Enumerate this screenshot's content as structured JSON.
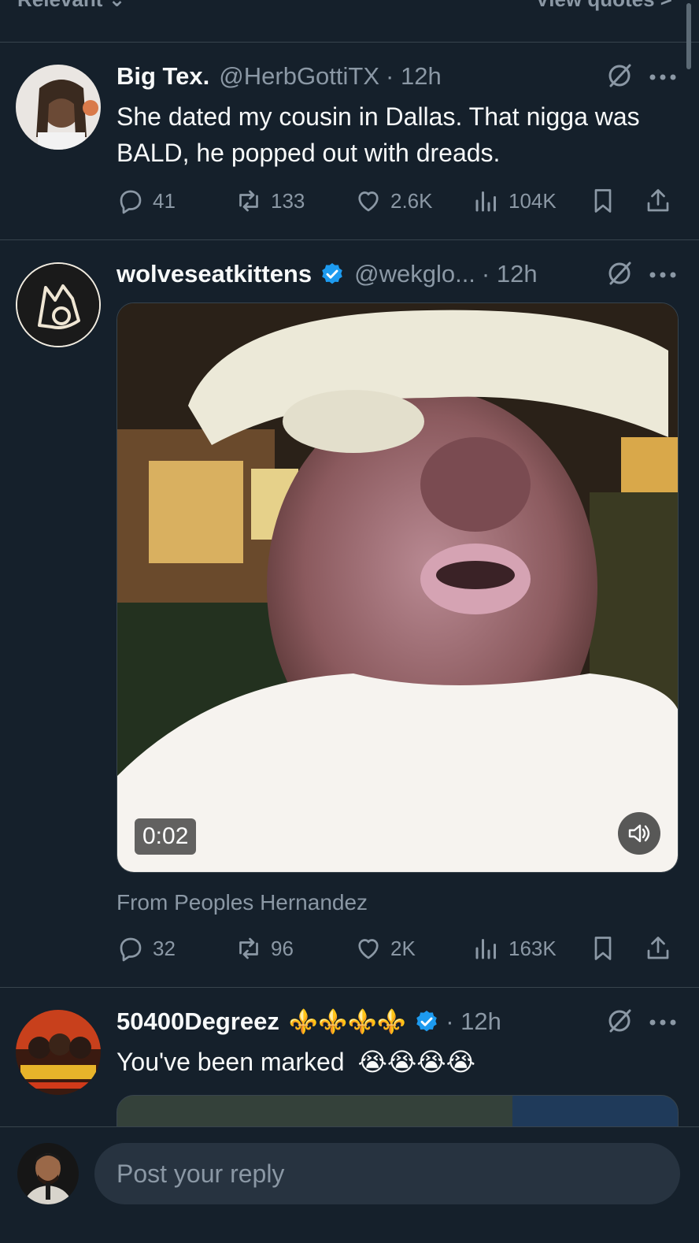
{
  "header": {
    "sort_label": "Relevant ⌄",
    "quotes_label": "View quotes >"
  },
  "tweets": [
    {
      "name": "Big Tex.",
      "handle": "@HerbGottiTX",
      "time": "· 12h",
      "text": "She dated my cousin in Dallas. That nigga was BALD, he popped out with dreads.",
      "stats": {
        "replies": "41",
        "reposts": "133",
        "likes": "2.6K",
        "views": "104K"
      }
    },
    {
      "name": "wolveseatkittens",
      "handle": "@wekglo...",
      "time": "· 12h",
      "verified": true,
      "video_duration": "0:02",
      "from_label": "From Peoples Hernandez",
      "stats": {
        "replies": "32",
        "reposts": "96",
        "likes": "2K",
        "views": "163K"
      }
    },
    {
      "name": "50400Degreez",
      "name_emojis": "⚜️⚜️⚜️⚜️",
      "time": "· 12h",
      "verified": true,
      "text": "You've been marked",
      "text_emojis": "😭😭😭😭"
    }
  ],
  "reply": {
    "placeholder": "Post your reply"
  },
  "colors": {
    "background": "#15202b",
    "secondary_text": "#8b98a5",
    "verified_blue": "#1d9bf0",
    "divider": "#38444d"
  }
}
